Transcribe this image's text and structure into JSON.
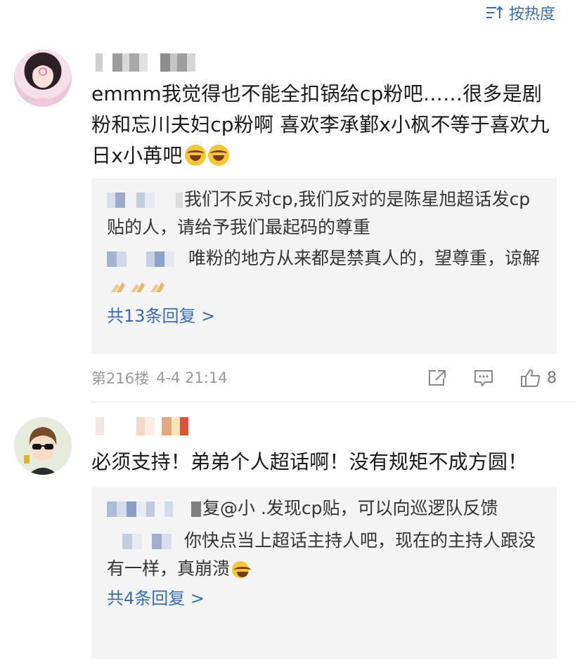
{
  "sort": {
    "label": "按热度"
  },
  "comments": [
    {
      "text": "emmm我觉得也不能全扣锅给cp粉吧……很多是剧粉和忘川夫妇cp粉啊 喜欢李承鄞x小枫不等于喜欢九日x小苒吧",
      "replies": [
        {
          "text": "我们不反对cp,我们反对的是陈星旭超话发cp贴的人，请给予我们最起码的尊重"
        },
        {
          "text": "唯粉的地方从来都是禁真人的，望尊重，谅解"
        }
      ],
      "more": "共13条回复 >",
      "floor": "第216楼",
      "time": "4-4 21:14",
      "likes": "8"
    },
    {
      "text": "必须支持！弟弟个人超话啊！没有规矩不成方圆！",
      "replies": [
        {
          "text": "复@小 .发现cp贴，可以向巡逻队反馈"
        },
        {
          "text": "你快点当上超话主持人吧，现在的主持人跟没有一样，真崩溃"
        }
      ],
      "more": "共4条回复 >"
    }
  ],
  "colors": {
    "link": "#3a6cb4",
    "reply_bg": "#f4f4f4",
    "meta": "#9a9a9a"
  }
}
